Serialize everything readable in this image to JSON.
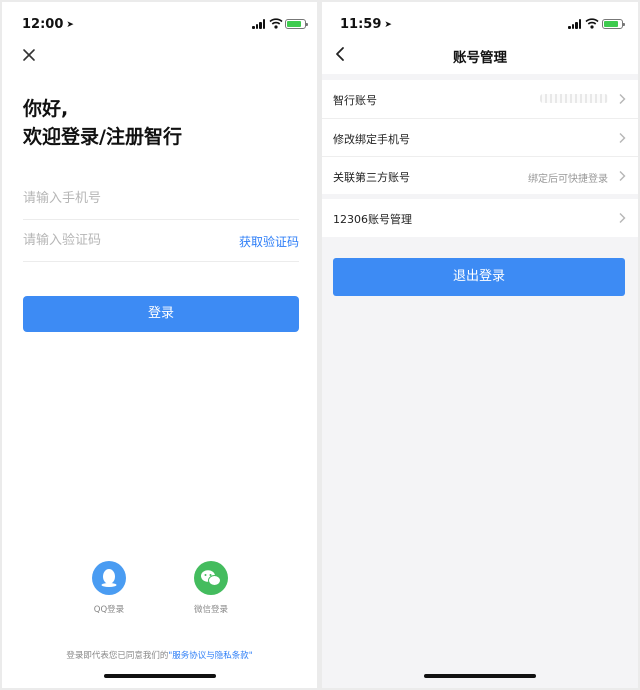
{
  "left_screen": {
    "status_bar": {
      "time": "12:00"
    },
    "greeting_line1": "你好,",
    "greeting_line2": "欢迎登录/注册智行",
    "phone_input": {
      "placeholder": "请输入手机号",
      "value": ""
    },
    "code_input": {
      "placeholder": "请输入验证码",
      "value": ""
    },
    "get_code_label": "获取验证码",
    "login_label": "登录",
    "social": [
      {
        "label": "QQ登录",
        "icon": "qq-icon",
        "color": "#4a9cf2"
      },
      {
        "label": "微信登录",
        "icon": "wechat-icon",
        "color": "#44bc5e"
      }
    ],
    "agreement_prefix": "登录即代表您已同意我们的",
    "agreement_link": "\"服务协议与隐私条款\""
  },
  "right_screen": {
    "status_bar": {
      "time": "11:59"
    },
    "title": "账号管理",
    "rows": [
      {
        "label": "智行账号",
        "hint": ""
      },
      {
        "label": "修改绑定手机号",
        "hint": ""
      },
      {
        "label": "关联第三方账号",
        "hint": "绑定后可快捷登录"
      }
    ],
    "row_12306": {
      "label": "12306账号管理"
    },
    "logout_label": "退出登录"
  },
  "colors": {
    "accent": "#3d8bf4",
    "link": "#2d7ef7",
    "battery": "#3ecb4e"
  }
}
